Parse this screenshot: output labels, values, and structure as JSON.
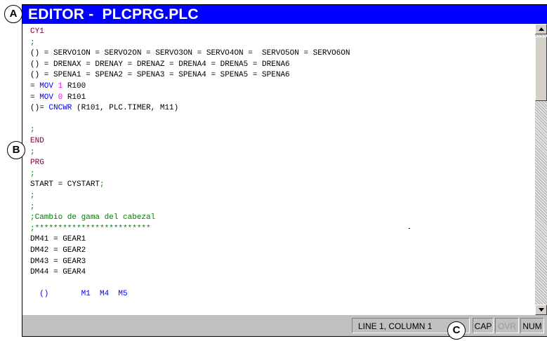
{
  "window": {
    "title": "EDITOR -  PLCPRG.PLC"
  },
  "editor": {
    "lines": [
      {
        "segments": [
          {
            "t": "CY1",
            "c": "kw"
          }
        ]
      },
      {
        "segments": [
          {
            "t": ";",
            "c": "com"
          }
        ]
      },
      {
        "segments": [
          {
            "t": "() = SERVO1ON = SERVO2ON = SERVO3ON = SERVO4ON =  SERVO5ON = SERVO6ON",
            "c": ""
          }
        ]
      },
      {
        "segments": [
          {
            "t": "() = DRENAX = DRENAY = DRENAZ = DRENA4 = DRENA5 = DRENA6",
            "c": ""
          }
        ]
      },
      {
        "segments": [
          {
            "t": "() = SPENA1 = SPENA2 = SPENA3 = SPENA4 = SPENA5 = SPENA6",
            "c": ""
          }
        ]
      },
      {
        "segments": [
          {
            "t": "= ",
            "c": ""
          },
          {
            "t": "MOV",
            "c": "cmd"
          },
          {
            "t": " ",
            "c": ""
          },
          {
            "t": "1",
            "c": "num"
          },
          {
            "t": " R100",
            "c": ""
          }
        ]
      },
      {
        "segments": [
          {
            "t": "= ",
            "c": ""
          },
          {
            "t": "MOV",
            "c": "cmd"
          },
          {
            "t": " ",
            "c": ""
          },
          {
            "t": "0",
            "c": "num"
          },
          {
            "t": " R101",
            "c": ""
          }
        ]
      },
      {
        "segments": [
          {
            "t": "()= ",
            "c": ""
          },
          {
            "t": "CNCWR",
            "c": "cmd"
          },
          {
            "t": " (R101, PLC.TIMER, M11)",
            "c": ""
          }
        ]
      },
      {
        "segments": []
      },
      {
        "segments": [
          {
            "t": ";",
            "c": "com"
          }
        ]
      },
      {
        "segments": [
          {
            "t": "END",
            "c": "kw"
          }
        ]
      },
      {
        "segments": [
          {
            "t": ";",
            "c": "com"
          }
        ]
      },
      {
        "segments": [
          {
            "t": "PRG",
            "c": "kw"
          }
        ]
      },
      {
        "segments": [
          {
            "t": ";",
            "c": "com"
          }
        ]
      },
      {
        "segments": [
          {
            "t": "START = CYSTART",
            "c": ""
          },
          {
            "t": ";",
            "c": "com"
          }
        ]
      },
      {
        "segments": [
          {
            "t": ";",
            "c": "com"
          }
        ]
      },
      {
        "segments": [
          {
            "t": ";",
            "c": "com"
          }
        ]
      },
      {
        "segments": [
          {
            "t": ";Cambio de gama del cabezal",
            "c": "com"
          }
        ]
      },
      {
        "segments": [
          {
            "t": ";*************************",
            "c": "com"
          }
        ]
      },
      {
        "segments": [
          {
            "t": "DM41 = GEAR1",
            "c": ""
          }
        ]
      },
      {
        "segments": [
          {
            "t": "DM42 = GEAR2",
            "c": ""
          }
        ]
      },
      {
        "segments": [
          {
            "t": "DM43 = GEAR3",
            "c": ""
          }
        ]
      },
      {
        "segments": [
          {
            "t": "DM44 = GEAR4",
            "c": ""
          }
        ]
      },
      {
        "segments": []
      },
      {
        "segments": [
          {
            "t": "  ()       M1  M4  M5",
            "c": "cut"
          }
        ]
      }
    ]
  },
  "status": {
    "position": "LINE 1, COLUMN 1",
    "cap": "CAP",
    "ovr": "OVR",
    "num": "NUM"
  },
  "callouts": {
    "a": "A",
    "b": "B",
    "c": "C"
  },
  "icons": {
    "scroll_up": "arrow-up-icon",
    "scroll_down": "arrow-down-icon"
  }
}
